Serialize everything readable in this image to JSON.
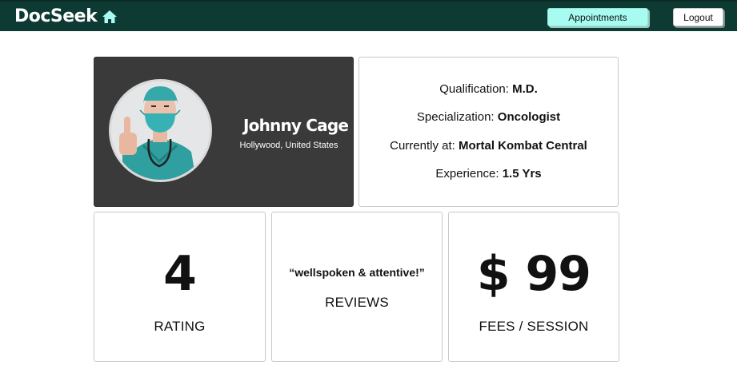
{
  "navbar": {
    "brand": "DocSeek",
    "brand_icon": "home-icon",
    "appointments_label": "Appointments",
    "logout_label": "Logout",
    "background": "#0d3a32",
    "accent": "#a8fbf1"
  },
  "profile": {
    "name": "Johnny Cage",
    "location": "Hollywood, United States"
  },
  "details": {
    "qualification_label": "Qualification:",
    "qualification_value": "M.D.",
    "specialization_label": "Specialization:",
    "specialization_value": "Oncologist",
    "current_label": "Currently at:",
    "current_value": "Mortal Kombat Central",
    "experience_label": "Experience:",
    "experience_value": "1.5 Yrs"
  },
  "stats": {
    "rating_value": "4",
    "rating_label": "RATING",
    "review_quote": "“wellspoken & attentive!”",
    "reviews_label": "REVIEWS",
    "fee_value": "$ 99",
    "fee_label": "FEES / SESSION"
  }
}
